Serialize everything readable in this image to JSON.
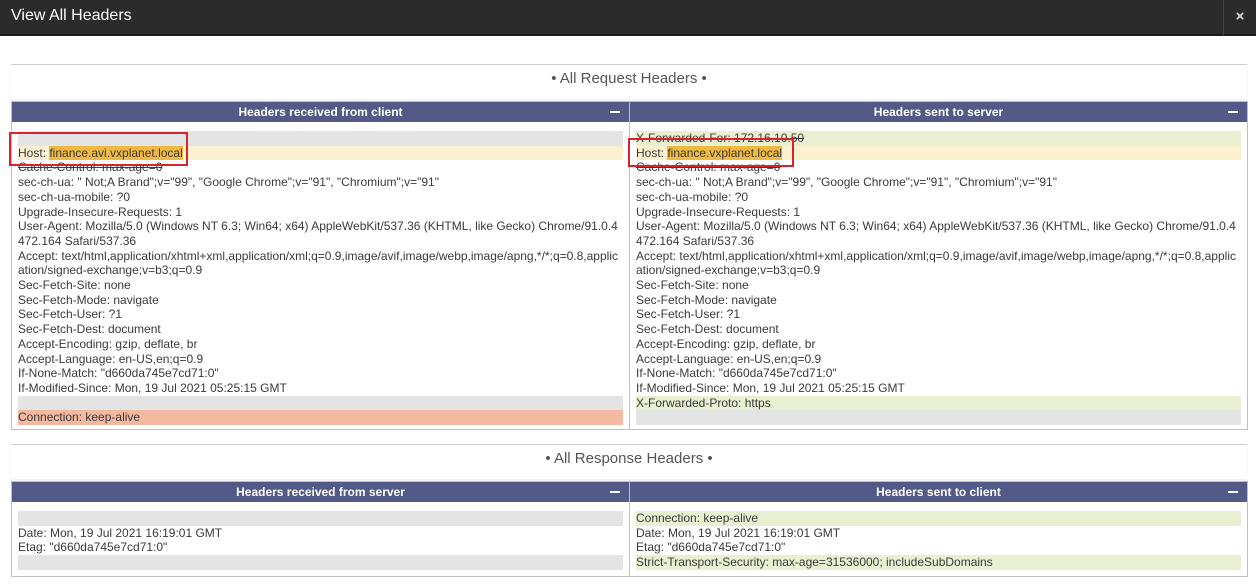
{
  "window": {
    "title": "View All Headers",
    "close_label": "×"
  },
  "request": {
    "section_title": "• All Request Headers •",
    "client": {
      "header": "Headers received from client",
      "lines": [
        {
          "text": "",
          "bg": "gray"
        },
        {
          "key": "Host: ",
          "value": "finance.avi.vxplanet.local",
          "bg": "yellow"
        },
        {
          "text": "Cache-Control: max-age=0",
          "strike": true
        },
        {
          "text": "sec-ch-ua: \" Not;A Brand\";v=\"99\", \"Google Chrome\";v=\"91\", \"Chromium\";v=\"91\""
        },
        {
          "text": "sec-ch-ua-mobile: ?0"
        },
        {
          "text": "Upgrade-Insecure-Requests: 1"
        },
        {
          "text": "User-Agent: Mozilla/5.0 (Windows NT 6.3; Win64; x64) AppleWebKit/537.36 (KHTML, like Gecko) Chrome/91.0.4472.164 Safari/537.36",
          "wrap": true
        },
        {
          "text": "Accept: text/html,application/xhtml+xml,application/xml;q=0.9,image/avif,image/webp,image/apng,*/*;q=0.8,application/signed-exchange;v=b3;q=0.9",
          "wrap": true
        },
        {
          "text": "Sec-Fetch-Site: none"
        },
        {
          "text": "Sec-Fetch-Mode: navigate"
        },
        {
          "text": "Sec-Fetch-User: ?1"
        },
        {
          "text": "Sec-Fetch-Dest: document"
        },
        {
          "text": "Accept-Encoding: gzip, deflate, br"
        },
        {
          "text": "Accept-Language: en-US,en;q=0.9"
        },
        {
          "text": "If-None-Match: \"d660da745e7cd71:0\""
        },
        {
          "text": "If-Modified-Since: Mon, 19 Jul 2021 05:25:15 GMT"
        },
        {
          "text": "",
          "bg": "gray"
        },
        {
          "text": "Connection: keep-alive",
          "bg": "salmon"
        }
      ]
    },
    "server": {
      "header": "Headers sent to server",
      "lines": [
        {
          "text": "X-Forwarded-For: 172.16.10.50",
          "bg": "green",
          "strike": true
        },
        {
          "key": "Host: ",
          "value": "finance.vxplanet.local",
          "bg": "yellow"
        },
        {
          "text": "Cache-Control: max-age=0",
          "strike": true
        },
        {
          "text": "sec-ch-ua: \" Not;A Brand\";v=\"99\", \"Google Chrome\";v=\"91\", \"Chromium\";v=\"91\""
        },
        {
          "text": "sec-ch-ua-mobile: ?0"
        },
        {
          "text": "Upgrade-Insecure-Requests: 1"
        },
        {
          "text": "User-Agent: Mozilla/5.0 (Windows NT 6.3; Win64; x64) AppleWebKit/537.36 (KHTML, like Gecko) Chrome/91.0.4472.164 Safari/537.36",
          "wrap": true
        },
        {
          "text": "Accept: text/html,application/xhtml+xml,application/xml;q=0.9,image/avif,image/webp,image/apng,*/*;q=0.8,application/signed-exchange;v=b3;q=0.9",
          "wrap": true
        },
        {
          "text": "Sec-Fetch-Site: none"
        },
        {
          "text": "Sec-Fetch-Mode: navigate"
        },
        {
          "text": "Sec-Fetch-User: ?1"
        },
        {
          "text": "Sec-Fetch-Dest: document"
        },
        {
          "text": "Accept-Encoding: gzip, deflate, br"
        },
        {
          "text": "Accept-Language: en-US,en;q=0.9"
        },
        {
          "text": "If-None-Match: \"d660da745e7cd71:0\""
        },
        {
          "text": "If-Modified-Since: Mon, 19 Jul 2021 05:25:15 GMT"
        },
        {
          "text": "X-Forwarded-Proto: https",
          "bg": "green"
        },
        {
          "text": "",
          "bg": "gray"
        }
      ]
    }
  },
  "response": {
    "section_title": "• All Response Headers •",
    "server": {
      "header": "Headers received from server",
      "lines": [
        {
          "text": "",
          "bg": "gray"
        },
        {
          "text": "Date: Mon, 19 Jul 2021 16:19:01 GMT"
        },
        {
          "text": "Etag: \"d660da745e7cd71:0\""
        },
        {
          "text": "",
          "bg": "gray"
        }
      ]
    },
    "client": {
      "header": "Headers sent to client",
      "lines": [
        {
          "text": "Connection: keep-alive",
          "bg": "green"
        },
        {
          "text": "Date: Mon, 19 Jul 2021 16:19:01 GMT"
        },
        {
          "text": "Etag: \"d660da745e7cd71:0\""
        },
        {
          "text": "Strict-Transport-Security: max-age=31536000; includeSubDomains",
          "bg": "green"
        }
      ]
    }
  },
  "colors": {
    "panel_header": "#545a87",
    "removed_gray": "#e4e4e4",
    "modified_yellow": "#fbf0cf",
    "added_green": "#e9f0d2",
    "client_only_salmon": "#f4b9a1",
    "host_highlight": "#f0b93f",
    "annotation_red": "#d6242a"
  }
}
